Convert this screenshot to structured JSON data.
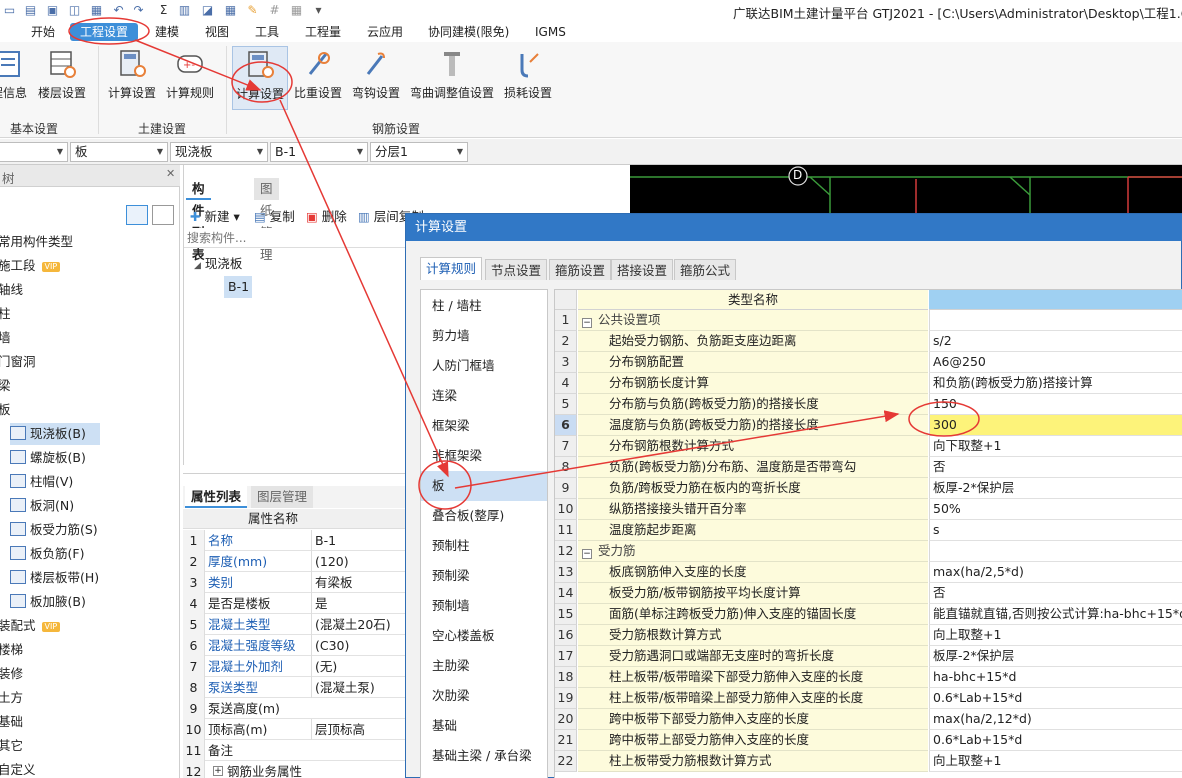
{
  "app": {
    "title": "广联达BIM土建计量平台 GTJ2021 - [C:\\Users\\Administrator\\Desktop\\工程1.GTJ]"
  },
  "menu": [
    "开始",
    "工程设置",
    "建模",
    "视图",
    "工具",
    "工程量",
    "云应用",
    "协同建模(限免)",
    "IGMS"
  ],
  "ribbon": {
    "groups": {
      "basic": "基本设置",
      "civil": "土建设置",
      "rebar": "钢筋设置"
    },
    "basic_items": [
      "程信息",
      "楼层设置"
    ],
    "civil_items": [
      "计算设置",
      "计算规则"
    ],
    "rebar_items": [
      "计算设置",
      "比重设置",
      "弯钩设置",
      "弯曲调整值设置",
      "损耗设置"
    ]
  },
  "combos": [
    "",
    "板",
    "现浇板",
    "B-1",
    "分层1"
  ],
  "left_tree": {
    "header": "树",
    "items": [
      "常用构件类型",
      "施工段",
      "轴线",
      "柱",
      "墙",
      "门窗洞",
      "梁",
      "板",
      "现浇板(B)",
      "螺旋板(B)",
      "柱帽(V)",
      "板洞(N)",
      "板受力筋(S)",
      "板负筋(F)",
      "楼层板带(H)",
      "板加腋(B)",
      "装配式",
      "楼梯",
      "装修",
      "土方",
      "基础",
      "其它",
      "自定义"
    ],
    "vip": "VIP"
  },
  "component_panel": {
    "tabs": [
      "构件列表",
      "图纸管理"
    ],
    "toolbar": [
      "新建",
      "复制",
      "删除",
      "层间复制"
    ],
    "search_placeholder": "搜索构件...",
    "tree_root": "现浇板",
    "tree_child": "B-1"
  },
  "property_panel": {
    "tabs": [
      "属性列表",
      "图层管理"
    ],
    "header": "属性名称",
    "rows": [
      {
        "n": "1",
        "k": "名称",
        "v": "B-1"
      },
      {
        "n": "2",
        "k": "厚度(mm)",
        "v": "(120)"
      },
      {
        "n": "3",
        "k": "类别",
        "v": "有梁板"
      },
      {
        "n": "4",
        "k": "是否是楼板",
        "v": "是"
      },
      {
        "n": "5",
        "k": "混凝土类型",
        "v": "(混凝土20石)"
      },
      {
        "n": "6",
        "k": "混凝土强度等级",
        "v": "(C30)"
      },
      {
        "n": "7",
        "k": "混凝土外加剂",
        "v": "(无)"
      },
      {
        "n": "8",
        "k": "泵送类型",
        "v": "(混凝土泵)"
      },
      {
        "n": "9",
        "k": "泵送高度(m)",
        "v": ""
      },
      {
        "n": "10",
        "k": "顶标高(m)",
        "v": "层顶标高"
      },
      {
        "n": "11",
        "k": "备注",
        "v": ""
      },
      {
        "n": "12",
        "k": "钢筋业务属性",
        "v": ""
      }
    ]
  },
  "canvas": {
    "axis_label": "D"
  },
  "dialog": {
    "title": "计算设置",
    "tabs": [
      "计算规则",
      "节点设置",
      "箍筋设置",
      "搭接设置",
      "箍筋公式"
    ],
    "categories": [
      "柱 / 墙柱",
      "剪力墙",
      "人防门框墙",
      "连梁",
      "框架梁",
      "非框架梁",
      "板",
      "叠合板(整厚)",
      "预制柱",
      "预制梁",
      "预制墙",
      "空心楼盖板",
      "主肋梁",
      "次肋梁",
      "基础",
      "基础主梁 / 承台梁"
    ],
    "selected_category": "板",
    "grid_header": "类型名称",
    "rows": [
      {
        "n": "1",
        "k": "公共设置项",
        "v": "",
        "section": true
      },
      {
        "n": "2",
        "k": "起始受力钢筋、负筋距支座边距离",
        "v": "s/2"
      },
      {
        "n": "3",
        "k": "分布钢筋配置",
        "v": "A6@250"
      },
      {
        "n": "4",
        "k": "分布钢筋长度计算",
        "v": "和负筋(跨板受力筋)搭接计算"
      },
      {
        "n": "5",
        "k": "分布筋与负筋(跨板受力筋)的搭接长度",
        "v": "150"
      },
      {
        "n": "6",
        "k": "温度筋与负筋(跨板受力筋)的搭接长度",
        "v": "300",
        "hl": true
      },
      {
        "n": "7",
        "k": "分布钢筋根数计算方式",
        "v": "向下取整+1"
      },
      {
        "n": "8",
        "k": "负筋(跨板受力筋)分布筋、温度筋是否带弯勾",
        "v": "否"
      },
      {
        "n": "9",
        "k": "负筋/跨板受力筋在板内的弯折长度",
        "v": "板厚-2*保护层"
      },
      {
        "n": "10",
        "k": "纵筋搭接接头错开百分率",
        "v": "50%"
      },
      {
        "n": "11",
        "k": "温度筋起步距离",
        "v": "s"
      },
      {
        "n": "12",
        "k": "受力筋",
        "v": "",
        "section": true
      },
      {
        "n": "13",
        "k": "板底钢筋伸入支座的长度",
        "v": "max(ha/2,5*d)"
      },
      {
        "n": "14",
        "k": "板受力筋/板带钢筋按平均长度计算",
        "v": "否"
      },
      {
        "n": "15",
        "k": "面筋(单标注跨板受力筋)伸入支座的锚固长度",
        "v": "能直锚就直锚,否则按公式计算:ha-bhc+15*d"
      },
      {
        "n": "16",
        "k": "受力筋根数计算方式",
        "v": "向上取整+1"
      },
      {
        "n": "17",
        "k": "受力筋遇洞口或端部无支座时的弯折长度",
        "v": "板厚-2*保护层"
      },
      {
        "n": "18",
        "k": "柱上板带/板带暗梁下部受力筋伸入支座的长度",
        "v": "ha-bhc+15*d"
      },
      {
        "n": "19",
        "k": "柱上板带/板带暗梁上部受力筋伸入支座的长度",
        "v": "0.6*Lab+15*d"
      },
      {
        "n": "20",
        "k": "跨中板带下部受力筋伸入支座的长度",
        "v": "max(ha/2,12*d)"
      },
      {
        "n": "21",
        "k": "跨中板带上部受力筋伸入支座的长度",
        "v": "0.6*Lab+15*d"
      },
      {
        "n": "22",
        "k": "柱上板带受力筋根数计算方式",
        "v": "向上取整+1"
      }
    ]
  },
  "colors": {
    "accent": "#3d8fd9",
    "annotation": "#e53935",
    "highlight": "#fdf37a",
    "keycell": "#fdfbdc"
  }
}
